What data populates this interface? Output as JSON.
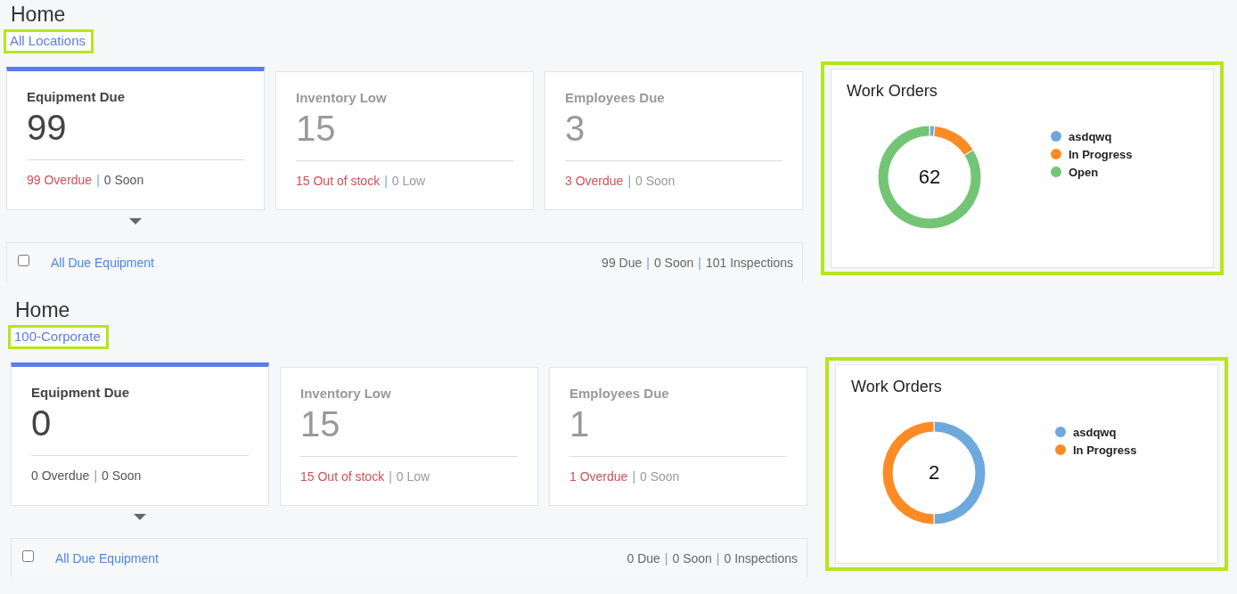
{
  "panels": [
    {
      "title": "Home",
      "location": {
        "label": "All Locations",
        "highlighted": true
      },
      "cards": [
        {
          "title": "Equipment Due",
          "value": "99",
          "selected": true,
          "separator": "|",
          "parts": [
            {
              "text": "99 Overdue",
              "alert": true
            },
            {
              "text": "0 Soon",
              "alert": false
            }
          ]
        },
        {
          "title": "Inventory Low",
          "value": "15",
          "selected": false,
          "separator": "|",
          "parts": [
            {
              "text": "15 Out of stock",
              "alert": true
            },
            {
              "text": "0 Low",
              "alert": false
            }
          ]
        },
        {
          "title": "Employees Due",
          "value": "3",
          "selected": false,
          "separator": "|",
          "parts": [
            {
              "text": "3 Overdue",
              "alert": true
            },
            {
              "text": "0 Soon",
              "alert": false
            }
          ]
        }
      ],
      "detail_row": {
        "checked": false,
        "link": "All Due Equipment",
        "separator": "|",
        "stats": [
          "99 Due",
          "0 Soon",
          "101 Inspections"
        ]
      },
      "work_orders": {
        "highlighted": true,
        "total": "62",
        "chart_data": {
          "type": "donut",
          "title": "Work Orders",
          "categories": [
            "asdqwq",
            "In Progress",
            "Open"
          ],
          "values": [
            1.6,
            14.5,
            83.9
          ],
          "colors": [
            "#6fa8dc",
            "#fd8b25",
            "#74c476"
          ]
        }
      }
    },
    {
      "title": "Home",
      "location": {
        "label": "100-Corporate",
        "highlighted": true
      },
      "cards": [
        {
          "title": "Equipment Due",
          "value": "0",
          "selected": true,
          "separator": "|",
          "parts": [
            {
              "text": "0 Overdue",
              "alert": false
            },
            {
              "text": "0 Soon",
              "alert": false
            }
          ]
        },
        {
          "title": "Inventory Low",
          "value": "15",
          "selected": false,
          "separator": "|",
          "parts": [
            {
              "text": "15 Out of stock",
              "alert": true
            },
            {
              "text": "0 Low",
              "alert": false
            }
          ]
        },
        {
          "title": "Employees Due",
          "value": "1",
          "selected": false,
          "separator": "|",
          "parts": [
            {
              "text": "1 Overdue",
              "alert": true
            },
            {
              "text": "0 Soon",
              "alert": false
            }
          ]
        }
      ],
      "detail_row": {
        "checked": false,
        "link": "All Due Equipment",
        "separator": "|",
        "stats": [
          "0 Due",
          "0 Soon",
          "0 Inspections"
        ]
      },
      "work_orders": {
        "highlighted": true,
        "total": "2",
        "chart_data": {
          "type": "donut",
          "title": "Work Orders",
          "categories": [
            "asdqwq",
            "In Progress"
          ],
          "values": [
            50,
            50
          ],
          "colors": [
            "#6fa8dc",
            "#fd8b25"
          ]
        }
      }
    }
  ]
}
